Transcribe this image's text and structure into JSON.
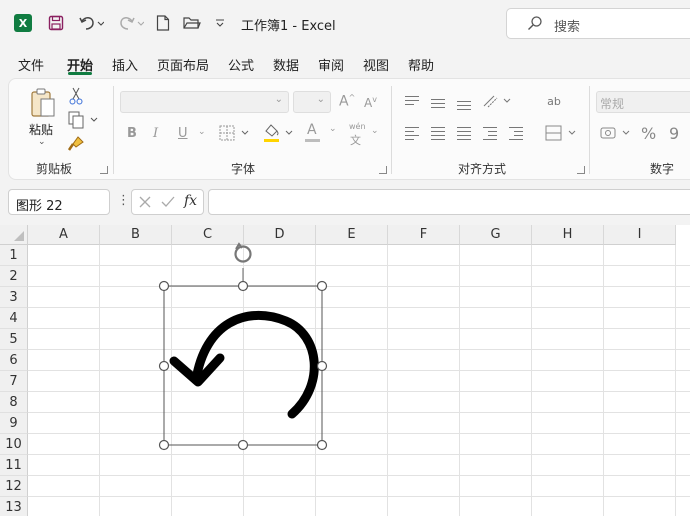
{
  "titlebar": {
    "app_icon": "excel-logo",
    "title": "工作簿1  -  Excel",
    "search_placeholder": "搜索",
    "icons": [
      "save-icon",
      "undo-icon",
      "redo-icon",
      "new-file-icon",
      "open-folder-icon",
      "customize-qat-icon"
    ]
  },
  "menu": {
    "tabs": [
      "文件",
      "开始",
      "插入",
      "页面布局",
      "公式",
      "数据",
      "审阅",
      "视图",
      "帮助"
    ],
    "active": "开始"
  },
  "ribbon": {
    "clipboard": {
      "label": "剪贴板",
      "paste_label": "粘贴"
    },
    "font": {
      "label": "字体",
      "grow": "A",
      "shrink": "A",
      "bold": "B",
      "italic": "I",
      "underline": "U",
      "phonetic_top": "wén",
      "phonetic_bottom": "文",
      "font_color_letter": "A"
    },
    "alignment": {
      "label": "对齐方式",
      "wrap_glyph": "ab"
    },
    "number": {
      "label": "数字",
      "format_value": "常规",
      "percent": "%",
      "comma": "9"
    }
  },
  "formula_bar": {
    "name_box": "图形 22",
    "fx": "fx",
    "value": ""
  },
  "grid": {
    "columns": [
      "A",
      "B",
      "C",
      "D",
      "E",
      "F",
      "G",
      "H",
      "I"
    ],
    "rows": [
      "1",
      "2",
      "3",
      "4",
      "5",
      "6",
      "7",
      "8",
      "9",
      "10",
      "11",
      "12",
      "13"
    ]
  },
  "shape": {
    "name": "undo-arrow-shape",
    "selected": true
  },
  "colors": {
    "accent": "#107c41",
    "font_color_bar": "#e64a19",
    "highlight": "#ffd400"
  }
}
